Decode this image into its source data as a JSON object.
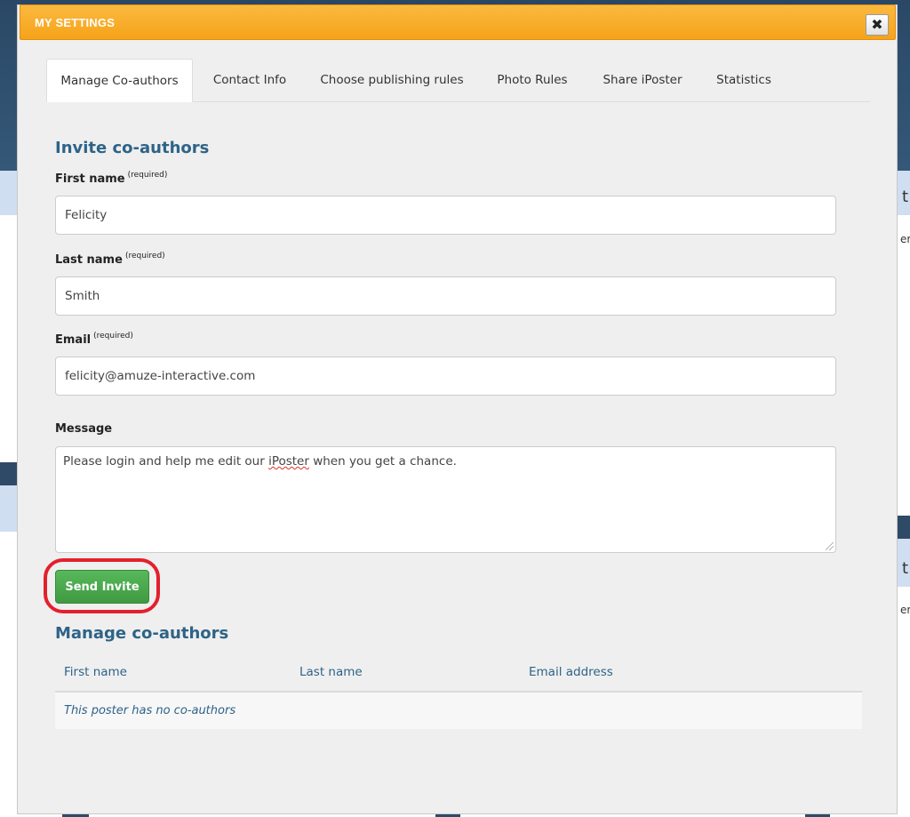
{
  "modal": {
    "title": "MY SETTINGS",
    "close_glyph": "✖"
  },
  "tabs": [
    {
      "label": "Manage Co-authors",
      "active": true
    },
    {
      "label": "Contact Info",
      "active": false
    },
    {
      "label": "Choose publishing rules",
      "active": false
    },
    {
      "label": "Photo Rules",
      "active": false
    },
    {
      "label": "Share iPoster",
      "active": false
    },
    {
      "label": "Statistics",
      "active": false
    }
  ],
  "invite": {
    "title": "Invite co-authors",
    "required_note": "(required)",
    "first_name": {
      "label": "First name",
      "value": "Felicity"
    },
    "last_name": {
      "label": "Last name",
      "value": "Smith"
    },
    "email": {
      "label": "Email",
      "value": "felicity@amuze-interactive.com"
    },
    "message": {
      "label": "Message",
      "value_before": "Please login and help me edit our ",
      "value_misspelled": "iPoster",
      "value_after": " when you get a chance."
    },
    "send_label": "Send Invite"
  },
  "manage": {
    "title": "Manage co-authors",
    "columns": [
      "First name",
      "Last name",
      "Email address"
    ],
    "empty_text": "This poster has no co-authors"
  },
  "background": {
    "fragments": [
      "t",
      "er",
      "t",
      "er"
    ]
  },
  "colors": {
    "header_orange": "#f6a31a",
    "accent_blue": "#2e6388",
    "button_green": "#4aa74d",
    "highlight_red": "#e3202d"
  },
  "icons": {
    "close": "close-icon",
    "resize": "resize-grip-icon"
  }
}
